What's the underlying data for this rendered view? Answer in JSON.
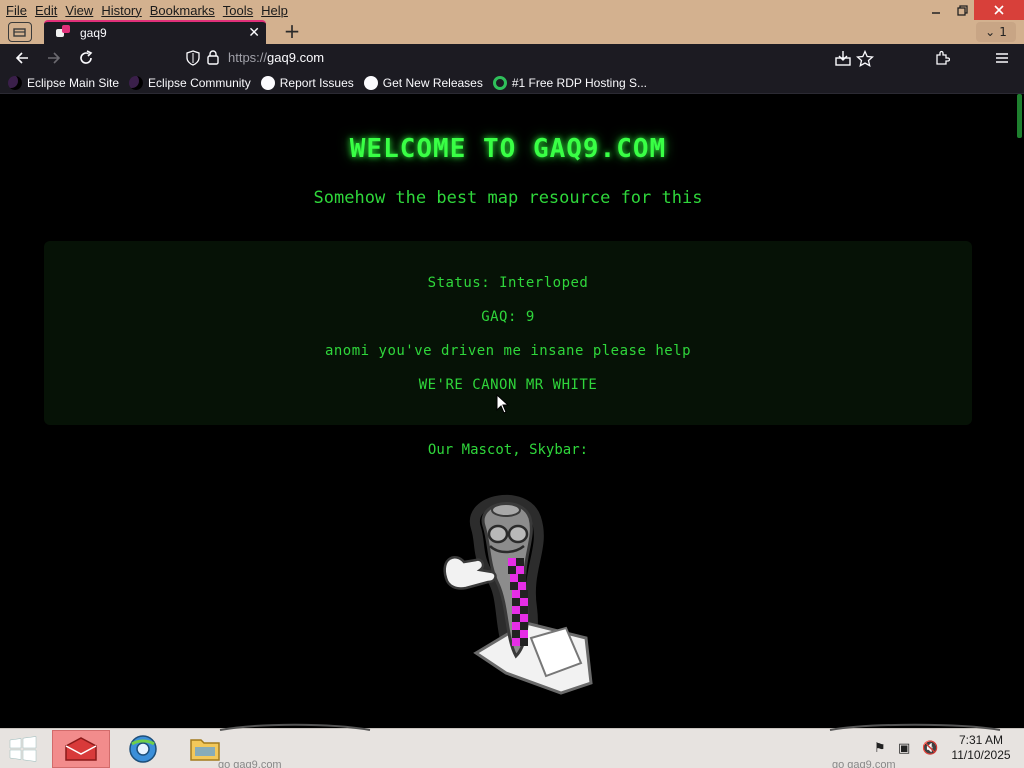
{
  "menubar": {
    "items": [
      "File",
      "Edit",
      "View",
      "History",
      "Bookmarks",
      "Tools",
      "Help"
    ]
  },
  "tabs": {
    "active_title": "gaq9",
    "tab_count": "1"
  },
  "navbar": {
    "url_scheme": "https://",
    "url_host": "gaq9.com"
  },
  "bookmarks": [
    {
      "label": "Eclipse Main Site",
      "icon": "eclipse-icon"
    },
    {
      "label": "Eclipse Community",
      "icon": "eclipse-icon"
    },
    {
      "label": "Report Issues",
      "icon": "github-icon"
    },
    {
      "label": "Get New Releases",
      "icon": "github-icon"
    },
    {
      "label": "#1 Free RDP Hosting S...",
      "icon": "rdp-icon"
    }
  ],
  "page": {
    "title": "WELCOME TO GAQ9.COM",
    "subtitle": "Somehow the best map resource for this",
    "status_lines": [
      "Status: Interloped",
      "GAQ: 9",
      "anomi you've driven me insane please help",
      "WE'RE CANON MR WHITE"
    ],
    "mascot_label": "Our Mascot, Skybar:"
  },
  "taskbar": {
    "time": "7:31 AM",
    "date": "11/10/2025",
    "ghost_left": "go gaq9.com",
    "ghost_right": "go gaq9.com"
  },
  "colors": {
    "accent_green": "#39ff45",
    "text_green": "#2fd63b",
    "chrome_bg": "#1c1b22",
    "titlebar_bg": "#d3b18f"
  }
}
